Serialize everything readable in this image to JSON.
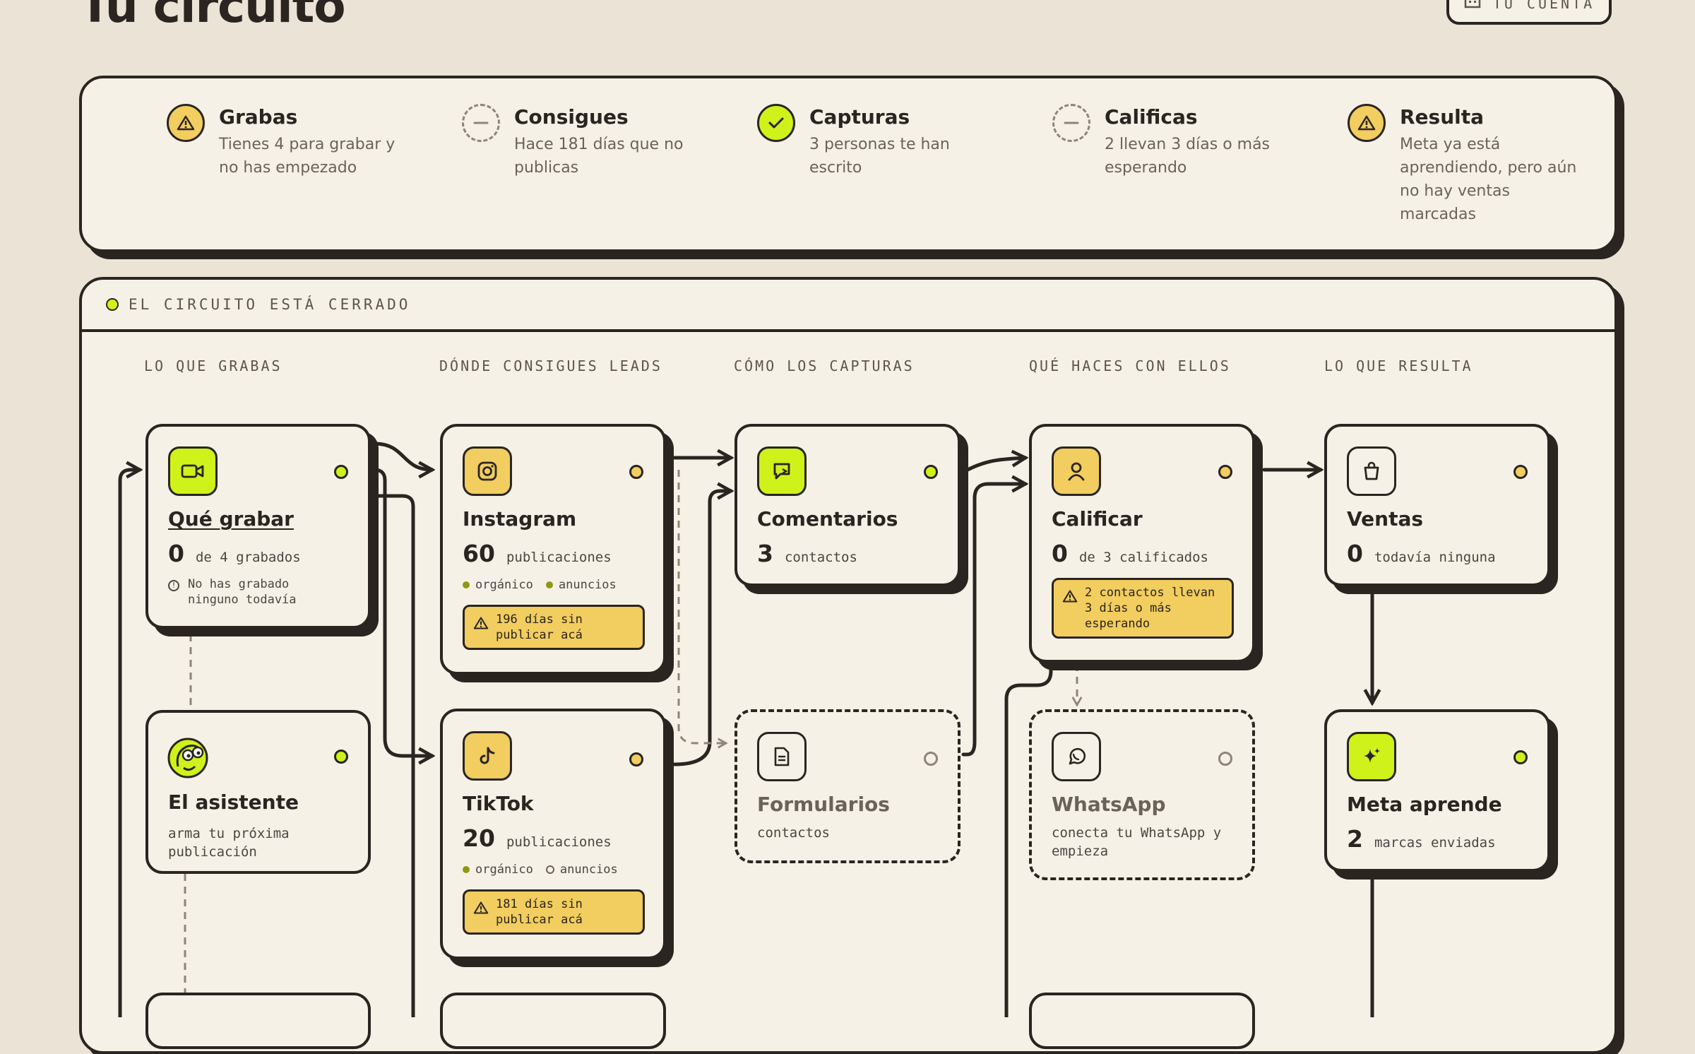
{
  "page": {
    "title": "Tu circuito",
    "account_label": "TU CUENTA",
    "account_icon": "building-icon"
  },
  "colors": {
    "lime": "#cff21a",
    "yellow": "#f2cd5f",
    "ink": "#2a2520",
    "paper": "#f5f1e7",
    "background": "#ebe3d6"
  },
  "summary": [
    {
      "status": "warning",
      "icon": "warning-icon",
      "title": "Grabas",
      "text": "Tienes 4 para grabar y no has empezado"
    },
    {
      "status": "pending",
      "icon": "dash-icon",
      "title": "Consigues",
      "text": "Hace 181 días que no publicas"
    },
    {
      "status": "ok",
      "icon": "check-icon",
      "title": "Capturas",
      "text": "3 personas te han escrito"
    },
    {
      "status": "pending",
      "icon": "dash-icon",
      "title": "Calificas",
      "text": "2 llevan 3 días o más esperando"
    },
    {
      "status": "warning",
      "icon": "warning-icon",
      "title": "Resulta",
      "text": "Meta ya está aprendiendo, pero aún no hay ventas marcadas"
    }
  ],
  "circuit": {
    "status": "EL CIRCUITO ESTÁ CERRADO",
    "columns": [
      "LO QUE GRABAS",
      "DÓNDE CONSIGUES LEADS",
      "CÓMO LOS CAPTURAS",
      "QUÉ HACES CON ELLOS",
      "LO QUE RESULTA"
    ],
    "nodes": {
      "que_grabar": {
        "title": "Qué grabar",
        "count": "0",
        "unit": "de 4 grabados",
        "note": "No has grabado ninguno todavía",
        "icon": "video-icon"
      },
      "asistente": {
        "title": "El asistente",
        "sub": "arma tu próxima publicación",
        "icon": "assistant-mascot-icon"
      },
      "instagram": {
        "title": "Instagram",
        "count": "60",
        "unit": "publicaciones",
        "organic": "orgánico",
        "ads": "anuncios",
        "alert": "196 días sin publicar acá",
        "icon": "instagram-icon"
      },
      "tiktok": {
        "title": "TikTok",
        "count": "20",
        "unit": "publicaciones",
        "organic": "orgánico",
        "ads": "anuncios",
        "alert": "181 días sin publicar acá",
        "icon": "tiktok-icon"
      },
      "comentarios": {
        "title": "Comentarios",
        "count": "3",
        "unit": "contactos",
        "icon": "comment-icon"
      },
      "formularios": {
        "title": "Formularios",
        "sub": "contactos",
        "icon": "form-icon"
      },
      "calificar": {
        "title": "Calificar",
        "count": "0",
        "unit": "de 3 calificados",
        "alert": "2 contactos llevan 3 días o más esperando",
        "icon": "user-icon"
      },
      "whatsapp": {
        "title": "WhatsApp",
        "sub": "conecta tu WhatsApp y empieza",
        "icon": "whatsapp-icon"
      },
      "ventas": {
        "title": "Ventas",
        "count": "0",
        "unit": "todavía ninguna",
        "icon": "shopping-bag-icon"
      },
      "meta": {
        "title": "Meta aprende",
        "count": "2",
        "unit": "marcas enviadas",
        "icon": "sparkle-icon"
      }
    }
  }
}
